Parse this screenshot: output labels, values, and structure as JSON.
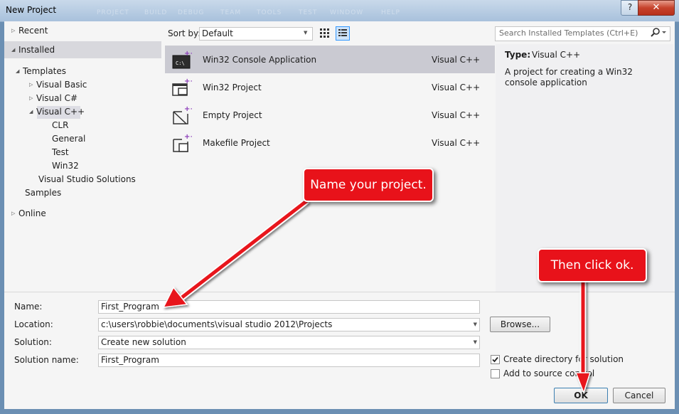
{
  "window": {
    "title": "New Project",
    "help_glyph": "?",
    "close_glyph": "✕",
    "ghost_menu": [
      "PROJECT",
      "BUILD",
      "DEBUG",
      "TEAM",
      "TOOLS",
      "TEST",
      "WINDOW",
      "HELP"
    ]
  },
  "tree": {
    "recent": "Recent",
    "installed": "Installed",
    "templates": "Templates",
    "visual_basic": "Visual Basic",
    "visual_csharp": "Visual C#",
    "visual_cpp": "Visual C++",
    "clr": "CLR",
    "general": "General",
    "test": "Test",
    "win32": "Win32",
    "vs_solutions": "Visual Studio Solutions",
    "samples": "Samples",
    "online": "Online"
  },
  "sort": {
    "label": "Sort by:",
    "value": "Default"
  },
  "templates": [
    {
      "name": "Win32 Console Application",
      "lang": "Visual C++",
      "icon": "console-app-icon",
      "selected": true
    },
    {
      "name": "Win32 Project",
      "lang": "Visual C++",
      "icon": "win32-project-icon",
      "selected": false
    },
    {
      "name": "Empty Project",
      "lang": "Visual C++",
      "icon": "empty-project-icon",
      "selected": false
    },
    {
      "name": "Makefile Project",
      "lang": "Visual C++",
      "icon": "makefile-project-icon",
      "selected": false
    }
  ],
  "search": {
    "placeholder": "Search Installed Templates (Ctrl+E)"
  },
  "details": {
    "type_label": "Type:",
    "type_value": "Visual C++",
    "description": "A project for creating a Win32 console application"
  },
  "form": {
    "name_label": "Name:",
    "name_value": "First_Program",
    "location_label": "Location:",
    "location_value": "c:\\users\\robbie\\documents\\visual studio 2012\\Projects",
    "solution_label": "Solution:",
    "solution_value": "Create new solution",
    "solution_name_label": "Solution name:",
    "solution_name_value": "First_Program",
    "browse_label": "Browse...",
    "create_dir_label": "Create directory for solution",
    "create_dir_checked": true,
    "source_control_label": "Add to source control",
    "source_control_checked": false,
    "ok_label": "OK",
    "cancel_label": "Cancel"
  },
  "annotations": {
    "name_hint": "Name your project.",
    "ok_hint": "Then click ok."
  },
  "colors": {
    "callout": "#e8121a",
    "selection": "#cacad2",
    "accent": "#3399ff"
  }
}
